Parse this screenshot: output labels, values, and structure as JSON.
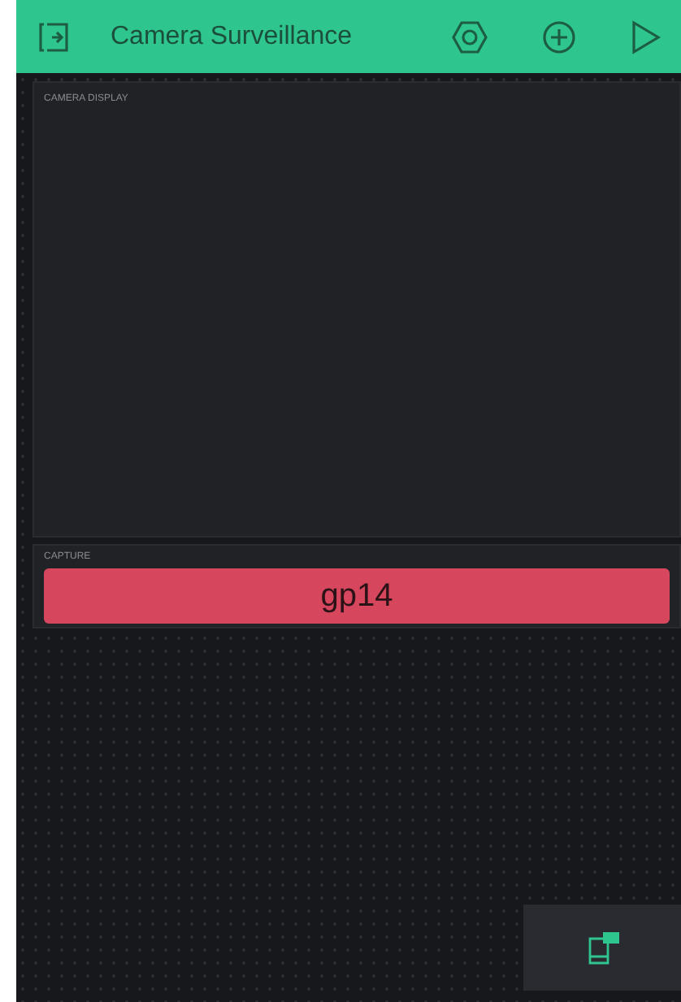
{
  "header": {
    "title": "Camera Surveillance"
  },
  "camera_display": {
    "label": "CAMERA DISPLAY"
  },
  "capture": {
    "label": "CAPTURE",
    "button": "gp14"
  }
}
